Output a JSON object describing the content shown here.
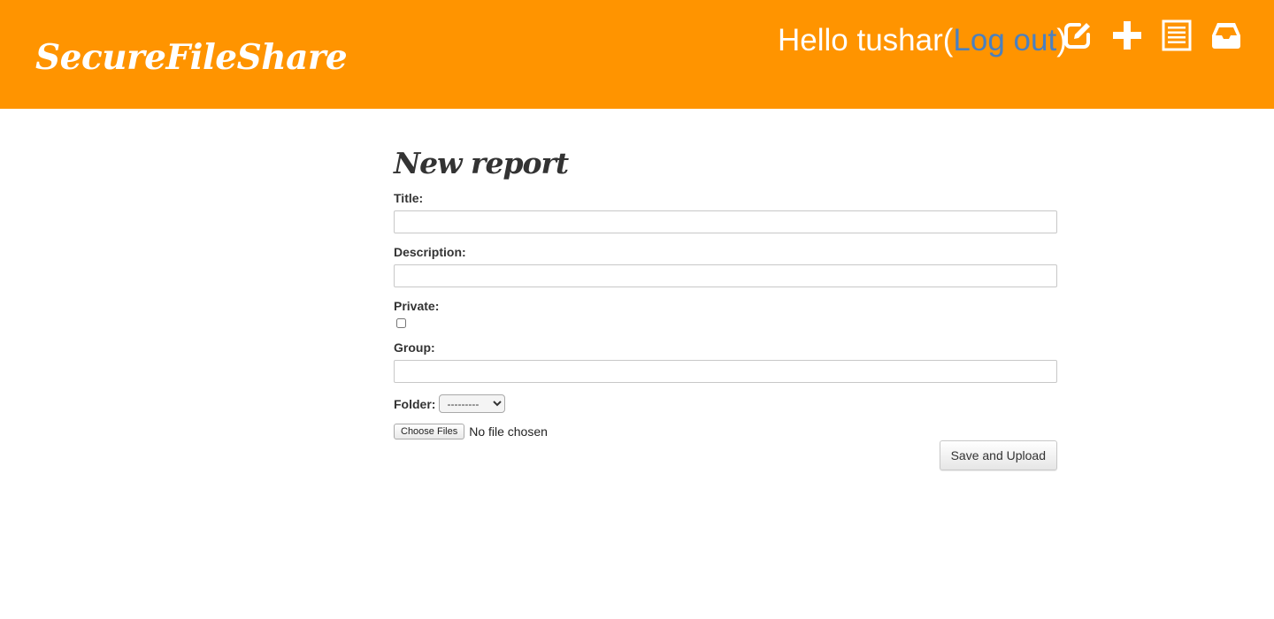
{
  "header": {
    "brand": "SecureFileShare",
    "greeting_prefix": "Hello tushar",
    "open_paren": "(",
    "logout_label": "Log out",
    "close_paren": ")",
    "background_color": "#ff9400",
    "link_color": "#4a80c0",
    "icons": [
      "edit-icon",
      "plus-icon",
      "list-icon",
      "inbox-icon"
    ]
  },
  "form": {
    "heading": "New report",
    "title_label": "Title:",
    "title_value": "",
    "description_label": "Description:",
    "description_value": "",
    "private_label": "Private:",
    "private_checked": false,
    "group_label": "Group:",
    "group_value": "",
    "folder_label": "Folder:",
    "folder_selected": "---------",
    "choose_files_label": "Choose Files",
    "file_status": "No file chosen",
    "submit_label": "Save and Upload"
  }
}
